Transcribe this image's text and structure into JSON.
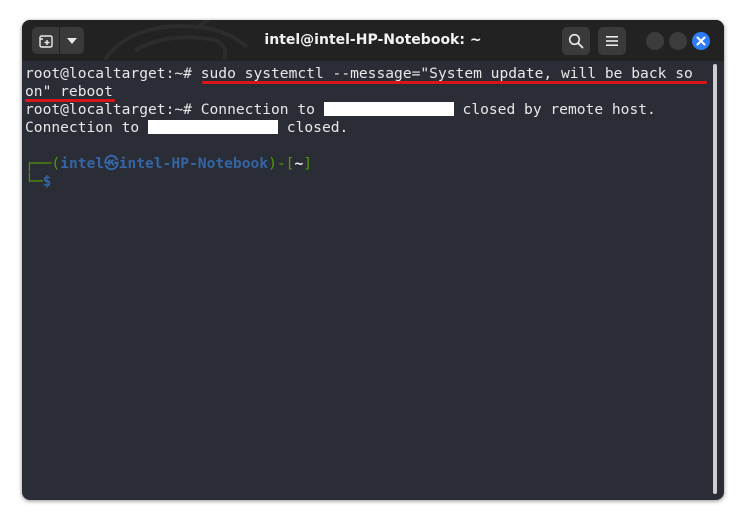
{
  "window": {
    "title": "intel@intel-HP-Notebook: ~"
  },
  "terminal": {
    "line1_prompt": "root@localtarget:~# ",
    "line1_cmd": "sudo systemctl --message=\"System update, will be back so",
    "line2_cmd": "on\" reboot",
    "line3_prompt": "root@localtarget:~# ",
    "line3_text_a": "Connection to ",
    "line3_text_b": " closed by remote host.",
    "line4_text_a": "Connection to ",
    "line4_text_b": " closed.",
    "prompt_open": "┌──(",
    "prompt_user": "intel",
    "prompt_host": "intel-HP-Notebook",
    "prompt_mid": ")-[",
    "prompt_dir": "~",
    "prompt_close": "]",
    "prompt2_corner": "└─",
    "prompt2_symbol": "$"
  },
  "icons": {
    "new_tab": "new-tab-icon",
    "menu_arrow": "chevron-down-icon",
    "search": "search-icon",
    "hamburger": "hamburger-menu-icon",
    "minimize": "minimize-icon",
    "maximize": "maximize-icon",
    "close": "close-icon",
    "kali_logo": "kali-dragon-icon"
  },
  "colors": {
    "terminal_bg": "#2b2d36",
    "titlebar_bg": "#222222",
    "annotation_red": "#d6161a",
    "prompt_green": "#4e9a06",
    "prompt_blue": "#3465a4",
    "close_blue": "#2e7cf6"
  }
}
